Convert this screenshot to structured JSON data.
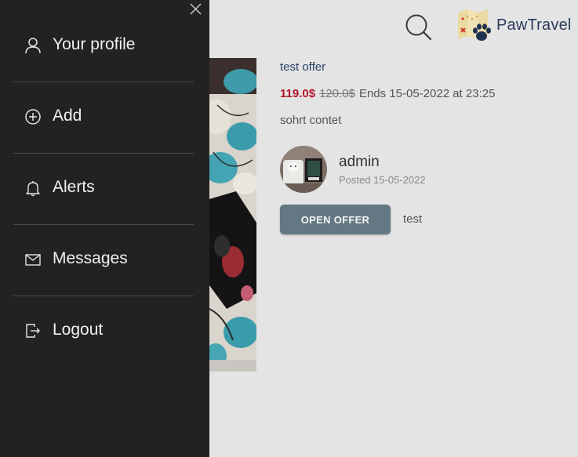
{
  "header": {
    "search_icon": "search-icon",
    "logo_text": "PawTravel"
  },
  "offer": {
    "title": "test offer",
    "price_new": "119.0$",
    "price_old": "120.0$",
    "ends": "Ends 15-05-2022 at 23:25",
    "description": "sohrt contet",
    "author": "admin",
    "posted": "Posted 15-05-2022",
    "open_button": "OPEN OFFER",
    "tag": "test"
  },
  "drawer": {
    "close_icon": "close-icon",
    "items": [
      {
        "label": "Your profile",
        "icon": "user-icon"
      },
      {
        "label": "Add",
        "icon": "plus-circle-icon"
      },
      {
        "label": "Alerts",
        "icon": "bell-icon"
      },
      {
        "label": "Messages",
        "icon": "envelope-icon"
      },
      {
        "label": "Logout",
        "icon": "logout-icon"
      }
    ]
  },
  "colors": {
    "drawer_bg": "#222222",
    "page_bg": "#e4e4e4",
    "price": "#b1162a",
    "button": "#637882",
    "brand": "#2b3a5c"
  }
}
